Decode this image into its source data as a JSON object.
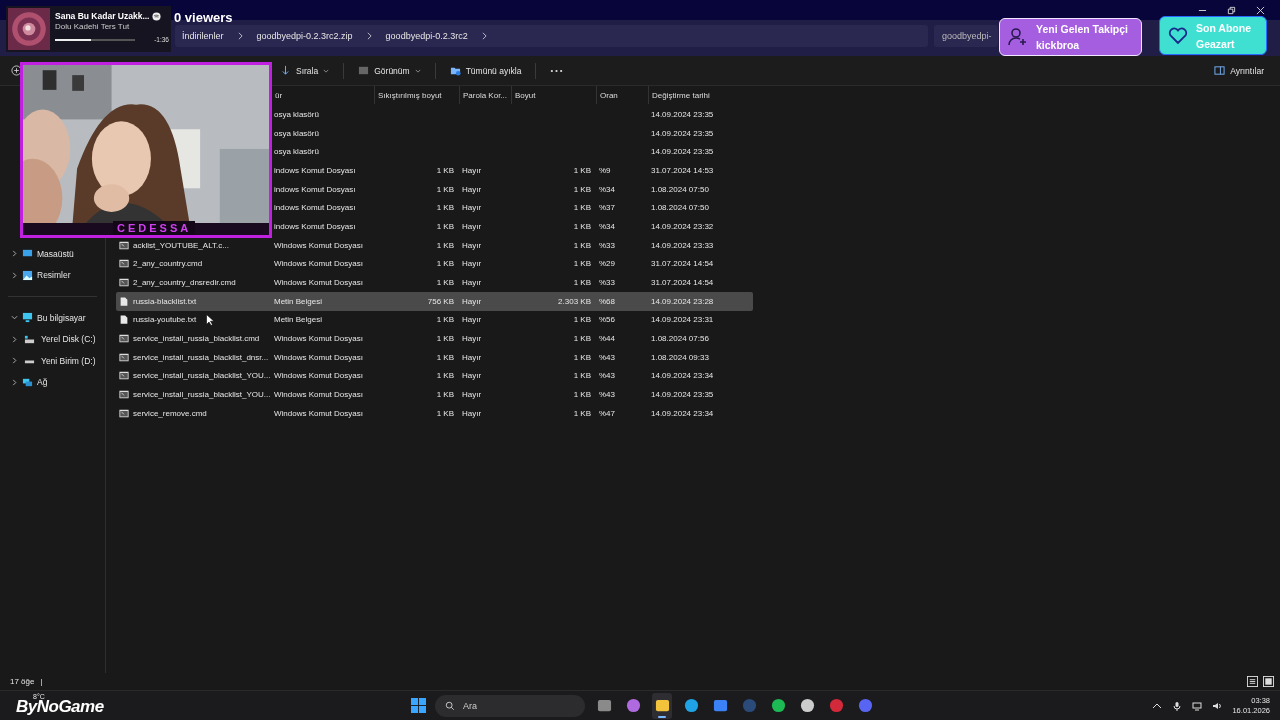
{
  "address_bar": {
    "breadcrumbs": [
      "İndirilenler",
      "goodbyedpi-0.2.3rc2.zip",
      "goodbyedpi-0.2.3rc2"
    ]
  },
  "search": {
    "placeholder": "goodbyedpi-"
  },
  "toolbar": {
    "items": [
      "Sırala",
      "Görünüm",
      "Tümünü ayıkla"
    ],
    "details": "Ayrıntılar"
  },
  "sidebar": {
    "items": [
      {
        "label": "Masaüstü",
        "kind": "desktop",
        "expanded": false
      },
      {
        "label": "Resimler",
        "kind": "pictures",
        "expanded": false
      },
      {
        "label": "Bu bilgisayar",
        "kind": "computer",
        "expanded": true,
        "children": [
          {
            "label": "Yerel Disk (C:)",
            "kind": "disk",
            "expanded": false
          },
          {
            "label": "Yeni Birim (D:)",
            "kind": "drive",
            "expanded": false
          }
        ]
      },
      {
        "label": "Ağ",
        "kind": "network",
        "expanded": false
      }
    ]
  },
  "table": {
    "columns": [
      "ür",
      "Sıkıştırılmış boyut",
      "Parola Kor...",
      "Boyut",
      "Oran",
      "Değiştirme tarihi"
    ],
    "rows": [
      {
        "type": "osya klasörü",
        "date": "14.09.2024 23:35",
        "selected": false
      },
      {
        "type": "osya klasörü",
        "date": "14.09.2024 23:35",
        "selected": false
      },
      {
        "type": "osya klasörü",
        "date": "14.09.2024 23:35",
        "selected": false
      },
      {
        "type": "indows Komut Dosyası",
        "compressed": "1 KB",
        "password": "Hayır",
        "size": "1 KB",
        "ratio": "%9",
        "date": "31.07.2024 14:53",
        "selected": false
      },
      {
        "type": "indows Komut Dosyası",
        "compressed": "1 KB",
        "password": "Hayır",
        "size": "1 KB",
        "ratio": "%34",
        "date": "1.08.2024 07:50",
        "selected": false
      },
      {
        "type": "indows Komut Dosyası",
        "compressed": "1 KB",
        "password": "Hayır",
        "size": "1 KB",
        "ratio": "%37",
        "date": "1.08.2024 07:50",
        "selected": false
      },
      {
        "type": "indows Komut Dosyası",
        "compressed": "1 KB",
        "password": "Hayır",
        "size": "1 KB",
        "ratio": "%34",
        "date": "14.09.2024 23:32",
        "selected": false
      },
      {
        "name": "acklist_YOUTUBE_ALT.c...",
        "kind": "cmd",
        "type": "Windows Komut Dosyası",
        "compressed": "1 KB",
        "password": "Hayır",
        "size": "1 KB",
        "ratio": "%33",
        "date": "14.09.2024 23:33",
        "selected": false
      },
      {
        "name": "2_any_country.cmd",
        "kind": "cmd",
        "type": "Windows Komut Dosyası",
        "compressed": "1 KB",
        "password": "Hayır",
        "size": "1 KB",
        "ratio": "%29",
        "date": "31.07.2024 14:54",
        "selected": false
      },
      {
        "name": "2_any_country_dnsredir.cmd",
        "kind": "cmd",
        "type": "Windows Komut Dosyası",
        "compressed": "1 KB",
        "password": "Hayır",
        "size": "1 KB",
        "ratio": "%33",
        "date": "31.07.2024 14:54",
        "selected": false
      },
      {
        "name": "russia-blacklist.txt",
        "kind": "txt",
        "type": "Metin Belgesi",
        "compressed": "756 KB",
        "password": "Hayır",
        "size": "2.303 KB",
        "ratio": "%68",
        "date": "14.09.2024 23:28",
        "selected": true
      },
      {
        "name": "russia-youtube.txt",
        "kind": "txt",
        "type": "Metin Belgesi",
        "compressed": "1 KB",
        "password": "Hayır",
        "size": "1 KB",
        "ratio": "%56",
        "date": "14.09.2024 23:31",
        "selected": false
      },
      {
        "name": "service_install_russia_blacklist.cmd",
        "kind": "cmd",
        "type": "Windows Komut Dosyası",
        "compressed": "1 KB",
        "password": "Hayır",
        "size": "1 KB",
        "ratio": "%44",
        "date": "1.08.2024 07:56",
        "selected": false
      },
      {
        "name": "service_install_russia_blacklist_dnsr...",
        "kind": "cmd",
        "type": "Windows Komut Dosyası",
        "compressed": "1 KB",
        "password": "Hayır",
        "size": "1 KB",
        "ratio": "%43",
        "date": "1.08.2024 09:33",
        "selected": false
      },
      {
        "name": "service_install_russia_blacklist_YOU...",
        "kind": "cmd",
        "type": "Windows Komut Dosyası",
        "compressed": "1 KB",
        "password": "Hayır",
        "size": "1 KB",
        "ratio": "%43",
        "date": "14.09.2024 23:34",
        "selected": false
      },
      {
        "name": "service_install_russia_blacklist_YOU...",
        "kind": "cmd",
        "type": "Windows Komut Dosyası",
        "compressed": "1 KB",
        "password": "Hayır",
        "size": "1 KB",
        "ratio": "%43",
        "date": "14.09.2024 23:35",
        "selected": false
      },
      {
        "name": "service_remove.cmd",
        "kind": "cmd",
        "type": "Windows Komut Dosyası",
        "compressed": "1 KB",
        "password": "Hayır",
        "size": "1 KB",
        "ratio": "%47",
        "date": "14.09.2024 23:34",
        "selected": false
      }
    ]
  },
  "status_bar": {
    "count": "17 öğe",
    "separator": "|"
  },
  "taskbar": {
    "weather": "8°C",
    "search_placeholder": "Ara",
    "apps": [
      {
        "kind": "taskview",
        "active": false
      },
      {
        "kind": "ribbon",
        "active": false
      },
      {
        "kind": "folder",
        "active": true
      },
      {
        "kind": "browser",
        "active": false
      },
      {
        "kind": "store",
        "active": false
      },
      {
        "kind": "steam",
        "active": false
      },
      {
        "kind": "music",
        "active": false
      },
      {
        "kind": "chrome",
        "active": false
      },
      {
        "kind": "red",
        "active": false
      },
      {
        "kind": "chat",
        "active": false
      }
    ],
    "time": "03:38",
    "date": "16.01.2026"
  },
  "stream_overlay": {
    "viewers": "0 viewers",
    "music": {
      "title": "Sana Bu Kadar Uzakk...",
      "artist": "Dolu Kadehi Ters Tut",
      "remaining": "-1:36",
      "level": 0.45
    },
    "follower_alert": {
      "heading": "Yeni Gelen Takipçi",
      "name": "kickbroa"
    },
    "subscriber_alert": {
      "heading": "Son Abone",
      "name": "Geazart"
    },
    "webcam": {
      "kind": "picture",
      "label": "CEDESSA"
    },
    "logo": "ByNoGame"
  }
}
